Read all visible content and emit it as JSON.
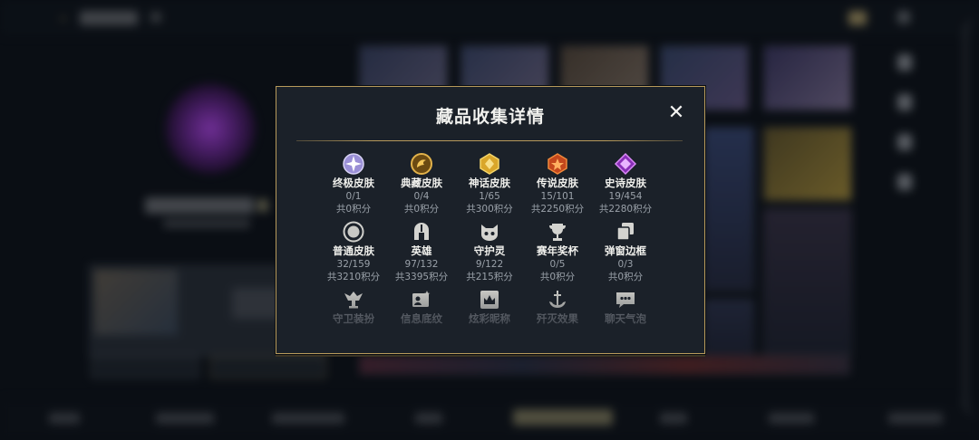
{
  "modal": {
    "title": "藏品收集详情",
    "close_icon": "✕"
  },
  "items": [
    {
      "icon": "ultimate-skin-icon",
      "name": "终极皮肤",
      "count": "0/1",
      "points": "共0积分"
    },
    {
      "icon": "collection-skin-icon",
      "name": "典藏皮肤",
      "count": "0/4",
      "points": "共0积分"
    },
    {
      "icon": "myth-skin-icon",
      "name": "神话皮肤",
      "count": "1/65",
      "points": "共300积分"
    },
    {
      "icon": "legend-skin-icon",
      "name": "传说皮肤",
      "count": "15/101",
      "points": "共2250积分"
    },
    {
      "icon": "epic-skin-icon",
      "name": "史诗皮肤",
      "count": "19/454",
      "points": "共2280积分"
    },
    {
      "icon": "normal-skin-icon",
      "name": "普通皮肤",
      "count": "32/159",
      "points": "共3210积分"
    },
    {
      "icon": "hero-helmet-icon",
      "name": "英雄",
      "count": "97/132",
      "points": "共3395积分"
    },
    {
      "icon": "guardian-spirit-icon",
      "name": "守护灵",
      "count": "9/122",
      "points": "共215积分"
    },
    {
      "icon": "trophy-icon",
      "name": "赛年奖杯",
      "count": "0/5",
      "points": "共0积分"
    },
    {
      "icon": "popup-frame-icon",
      "name": "弹窗边框",
      "count": "0/3",
      "points": "共0积分"
    },
    {
      "icon": "guard-outfit-icon",
      "name": "守卫装扮"
    },
    {
      "icon": "info-card-icon",
      "name": "信息底纹"
    },
    {
      "icon": "colorful-title-icon",
      "name": "炫彩昵称"
    },
    {
      "icon": "anchor-effect-icon",
      "name": "歼灭效果"
    },
    {
      "icon": "chat-bubble-icon",
      "name": "聊天气泡"
    }
  ],
  "colors": {
    "modal_bg": "#1b2129",
    "gold_border": "#b79a5b",
    "title": "#f1f1ee",
    "subtext": "#9aa1a9"
  }
}
